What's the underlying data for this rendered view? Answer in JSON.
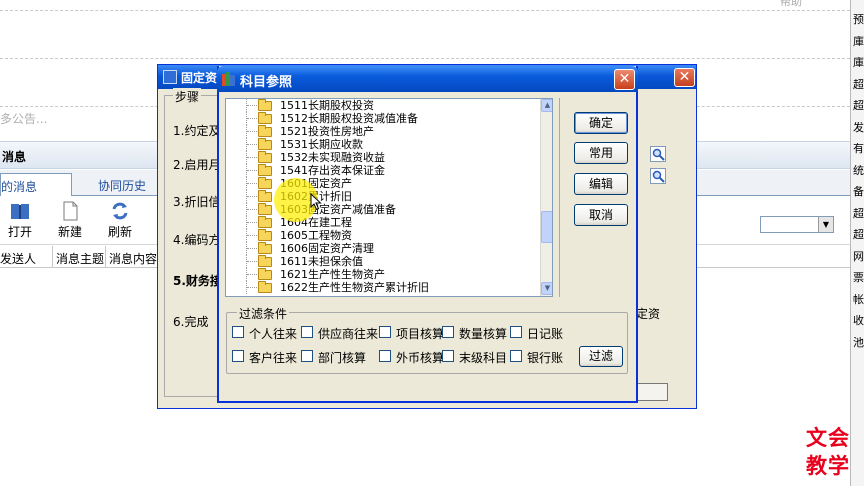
{
  "background": {
    "notice_text": "多公告...",
    "message_bar_title": "消息",
    "tabs": [
      "的消息",
      "协同历史"
    ],
    "toolbar": [
      "打开",
      "新建",
      "刷新"
    ],
    "columns": [
      "发送人",
      "消息主题",
      "消息内容"
    ],
    "right_sidebar_chars": [
      "预",
      "庫",
      "庫",
      "超",
      "超",
      "发",
      "有",
      "统",
      "备",
      "超",
      "超",
      "网",
      "票",
      "帐",
      "收",
      "池"
    ],
    "top_right_fragment": "帮助"
  },
  "wizard": {
    "title": "固定资",
    "steps_label": "步骤",
    "steps": [
      "1.约定及",
      "2.启用月",
      "3.折旧信",
      "4.编码方",
      "5.财务接",
      "6.完成"
    ],
    "right_text": "定资"
  },
  "dialog": {
    "title": "科目参照",
    "accounts": [
      {
        "code": "1511",
        "name": "长期股权投资"
      },
      {
        "code": "1512",
        "name": "长期股权投资减值准备"
      },
      {
        "code": "1521",
        "name": "投资性房地产"
      },
      {
        "code": "1531",
        "name": "长期应收款"
      },
      {
        "code": "1532",
        "name": "未实现融资收益"
      },
      {
        "code": "1541",
        "name": "存出资本保证金"
      },
      {
        "code": "1601",
        "name": "固定资产"
      },
      {
        "code": "1602",
        "name": "累计折旧"
      },
      {
        "code": "1603",
        "name": "固定资产减值准备"
      },
      {
        "code": "1604",
        "name": "在建工程"
      },
      {
        "code": "1605",
        "name": "工程物资"
      },
      {
        "code": "1606",
        "name": "固定资产清理"
      },
      {
        "code": "1611",
        "name": "未担保余值"
      },
      {
        "code": "1621",
        "name": "生产性生物资产"
      },
      {
        "code": "1622",
        "name": "生产性生物资产累计折旧"
      }
    ],
    "buttons": {
      "ok": "确定",
      "common": "常用",
      "edit": "编辑",
      "cancel": "取消"
    },
    "filter": {
      "label": "过滤条件",
      "checkboxes_row1": [
        "个人往来",
        "供应商往来",
        "项目核算",
        "数量核算",
        "日记账"
      ],
      "checkboxes_row2": [
        "客户往来",
        "部门核算",
        "外币核算",
        "末级科目",
        "银行账"
      ],
      "filter_button": "过滤"
    }
  },
  "watermark": [
    "文会",
    "教学"
  ],
  "colors": {
    "titlebar_blue": "#0a57d8",
    "close_red": "#c1401f",
    "dialog_face": "#ece9d8",
    "highlight_yellow": "#ffee00",
    "watermark_red": "#e8001c"
  }
}
